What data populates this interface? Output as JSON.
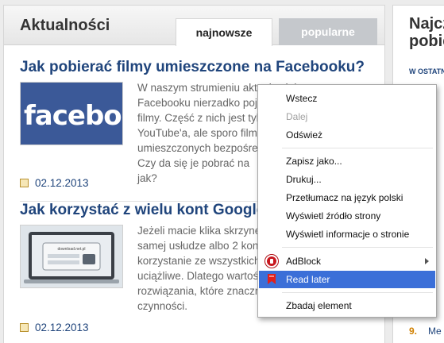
{
  "news": {
    "title": "Aktualności",
    "tabs": [
      "najnowsze",
      "popularne"
    ],
    "articles": [
      {
        "title": "Jak pobierać filmy umieszczone na Facebooku?",
        "thumb_text": "facebook",
        "excerpt": [
          "W naszym strumieniu aktualności na",
          "Facebooku nierzadko pojawiają się",
          "filmy. Część z nich jest tylko",
          "YouTube'a, ale sporo filmów",
          "umieszczonych bezpośrednio",
          "Czy da się je pobrać na",
          "jak?"
        ],
        "date": "02.12.2013"
      },
      {
        "title": "Jak korzystać z wielu kont Google j",
        "thumb_text": "download.net.pl",
        "excerpt": [
          "Jeżeli macie klika skrzynek",
          "samej usłudze albo 2 kont",
          "korzystanie ze wszystkich",
          "uciążliwe. Dlatego wartość",
          "rozwiązania, które znacznie ułatwią tego typu",
          "czynności."
        ],
        "date": "02.12.2013"
      }
    ]
  },
  "sidebar": {
    "title_lines": [
      "Najcz",
      "pobie"
    ],
    "subtitle": "W OSTATNI",
    "items": [
      {
        "num": "9.",
        "text": "Me"
      }
    ]
  },
  "context_menu": {
    "items": [
      {
        "label": "Wstecz",
        "disabled": false
      },
      {
        "label": "Dalej",
        "disabled": true
      },
      {
        "label": "Odśwież",
        "disabled": false
      },
      {
        "label": "Zapisz jako...",
        "disabled": false
      },
      {
        "label": "Drukuj...",
        "disabled": false
      },
      {
        "label": "Przetłumacz na język polski",
        "disabled": false
      },
      {
        "label": "Wyświetl źródło strony",
        "disabled": false
      },
      {
        "label": "Wyświetl informacje o stronie",
        "disabled": false
      },
      {
        "label": "AdBlock",
        "disabled": false,
        "icon": "adblock-icon",
        "submenu": true
      },
      {
        "label": "Read later",
        "disabled": false,
        "icon": "read-later-icon",
        "highlighted": true
      },
      {
        "label": "Zbadaj element",
        "disabled": false
      }
    ]
  },
  "colors": {
    "link": "#20457c",
    "menu_highlight": "#3b6fd8",
    "facebook_blue": "#3b5998"
  }
}
